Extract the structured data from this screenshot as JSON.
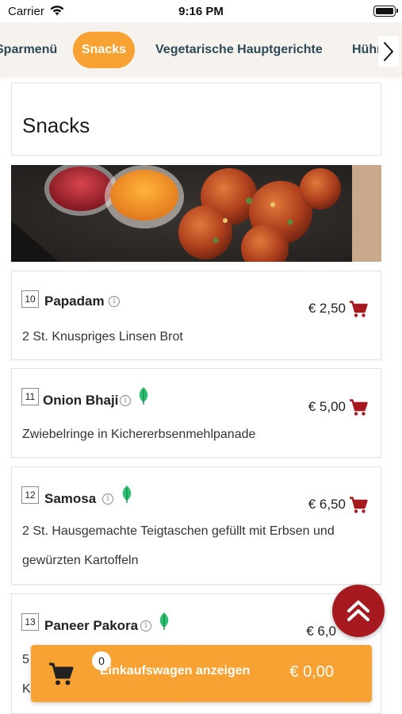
{
  "status_bar": {
    "carrier": "Carrier",
    "time": "9:16 PM"
  },
  "categories": {
    "tabs": [
      {
        "label": "Sparmenü"
      },
      {
        "label": "Snacks",
        "selected": true
      },
      {
        "label": "Vegetarische Hauptgerichte"
      },
      {
        "label": "Hühn"
      }
    ]
  },
  "section": {
    "title": "Snacks"
  },
  "items": [
    {
      "number": "10",
      "name": "Papadam",
      "price": "€ 2,50",
      "description": "2 St. Knuspriges Linsen Brot",
      "vegetarian": false
    },
    {
      "number": "11",
      "name": "Onion Bhaji",
      "price": "€ 5,00",
      "description": "Zwiebelringe in Kichererbsenmehlpanade",
      "vegetarian": true
    },
    {
      "number": "12",
      "name": "Samosa",
      "price": "€ 6,50",
      "description": "2 St. Hausgemachte Teigtaschen gefüllt mit Erbsen und gewürzten Kartoffeln",
      "vegetarian": true
    },
    {
      "number": "13",
      "name": "Paneer Pakora",
      "price": "€ 6,0",
      "description": "5",
      "description2": "K",
      "vegetarian": true
    }
  ],
  "cart": {
    "count": "0",
    "label": "Einkaufswagen anzeigen",
    "total": "€ 0,00"
  },
  "colors": {
    "accent": "#f7a232",
    "cart_icon": "#a61a1f",
    "leaf": "#2fbf71",
    "tab_text": "#2c4a57"
  },
  "icons": {
    "cart": "shopping-cart-icon",
    "info": "info-icon",
    "leaf": "vegetarian-leaf-icon",
    "scroll_top": "double-chevron-up-icon",
    "tabs_next": "chevron-right-icon"
  }
}
